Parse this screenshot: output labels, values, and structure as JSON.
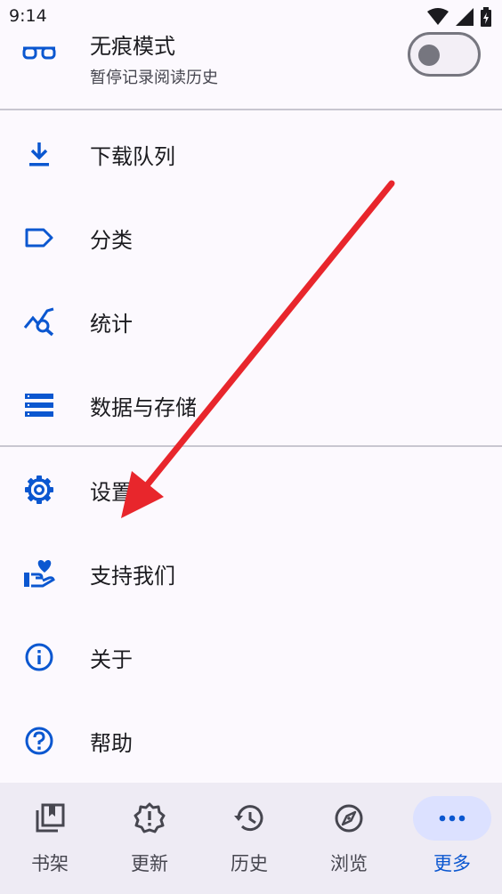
{
  "status_bar": {
    "time": "9:14"
  },
  "incognito": {
    "title": "无痕模式",
    "subtitle": "暂停记录阅读历史",
    "toggle_on": false
  },
  "menu": {
    "download_queue": "下载队列",
    "categories": "分类",
    "statistics": "统计",
    "data_storage": "数据与存储",
    "settings": "设置",
    "support": "支持我们",
    "about": "关于",
    "help": "帮助"
  },
  "bottom_nav": {
    "library": "书架",
    "updates": "更新",
    "history": "历史",
    "browse": "浏览",
    "more": "更多",
    "active": "更多"
  },
  "colors": {
    "accent": "#0b57d0",
    "arrow": "#e8262c"
  }
}
